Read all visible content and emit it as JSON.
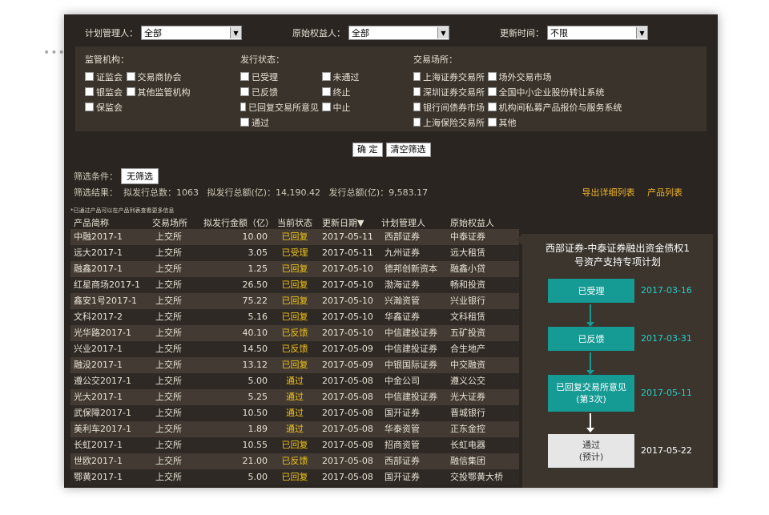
{
  "filters": {
    "plan_manager": {
      "label": "计划管理人：",
      "value": "全部"
    },
    "original_owner": {
      "label": "原始权益人：",
      "value": "全部"
    },
    "update_time": {
      "label": "更新时间：",
      "value": "不限"
    }
  },
  "regulators": {
    "title": "监管机构：",
    "options": [
      "证监会",
      "交易商协会",
      "银监会",
      "其他监管机构",
      "保监会"
    ]
  },
  "issue_status": {
    "title": "发行状态：",
    "options": [
      "已受理",
      "未通过",
      "已反馈",
      "终止",
      "已回复交易所意见",
      "中止",
      "通过"
    ]
  },
  "exchange": {
    "title": "交易场所：",
    "options": [
      "上海证券交易所",
      "场外交易市场",
      "深圳证券交易所",
      "全国中小企业股份转让系统",
      "银行间债券市场",
      "机构间私募产品报价与服务系统",
      "上海保险交易所",
      "其他"
    ]
  },
  "buttons": {
    "confirm": "确 定",
    "clear": "清空筛选"
  },
  "summary": {
    "cond_label": "筛选条件：",
    "cond_value": "无筛选",
    "result_text": "筛选结果：  拟发行总数：1063   拟发行总额(亿)：14,190.42   发行总额(亿)：9,583.17"
  },
  "links": {
    "export": "导出详细列表",
    "product_list": "产品列表"
  },
  "note": "*已通过产品可以在产品列表查看更多信息",
  "table": {
    "headers": [
      "产品简称",
      "交易场所",
      "拟发行金额（亿）",
      "当前状态",
      "更新日期▼",
      "计划管理人",
      "原始权益人"
    ],
    "rows": [
      [
        "中融2017-1",
        "上交所",
        "10.00",
        "已回复",
        "2017-05-11",
        "西部证券",
        "中泰证券"
      ],
      [
        "远大2017-1",
        "上交所",
        "3.05",
        "已受理",
        "2017-05-11",
        "九州证券",
        "远大租赁"
      ],
      [
        "融鑫2017-1",
        "上交所",
        "1.25",
        "已回复",
        "2017-05-10",
        "德邦创新资本",
        "融鑫小贷"
      ],
      [
        "红星商场2017-1",
        "上交所",
        "26.50",
        "已回复",
        "2017-05-10",
        "渤海证券",
        "畅和投资"
      ],
      [
        "鑫安1号2017-1",
        "上交所",
        "75.22",
        "已回复",
        "2017-05-10",
        "兴瀚资管",
        "兴业银行"
      ],
      [
        "文科2017-2",
        "上交所",
        "5.16",
        "已回复",
        "2017-05-10",
        "华鑫证券",
        "文科租赁"
      ],
      [
        "光华路2017-1",
        "上交所",
        "40.10",
        "已反馈",
        "2017-05-10",
        "中信建投证券",
        "五矿投资"
      ],
      [
        "兴业2017-1",
        "上交所",
        "14.50",
        "已反馈",
        "2017-05-09",
        "中信建投证券",
        "合生地产"
      ],
      [
        "融没2017-1",
        "上交所",
        "13.12",
        "已回复",
        "2017-05-09",
        "中银国际证券",
        "中交融资"
      ],
      [
        "遵公交2017-1",
        "上交所",
        "5.00",
        "通过",
        "2017-05-08",
        "中金公司",
        "遵义公交"
      ],
      [
        "光大2017-1",
        "上交所",
        "5.25",
        "通过",
        "2017-05-08",
        "中信建投证券",
        "光大证券"
      ],
      [
        "武保障2017-1",
        "上交所",
        "10.50",
        "通过",
        "2017-05-08",
        "国开证券",
        "晋城银行"
      ],
      [
        "美利车2017-1",
        "上交所",
        "1.89",
        "通过",
        "2017-05-08",
        "华泰资管",
        "正东金控"
      ],
      [
        "长虹2017-1",
        "上交所",
        "10.55",
        "已回复",
        "2017-05-08",
        "招商资管",
        "长虹电器"
      ],
      [
        "世欧2017-1",
        "上交所",
        "21.00",
        "已反馈",
        "2017-05-08",
        "西部证券",
        "融信集团"
      ],
      [
        "鄂黄2017-1",
        "上交所",
        "5.00",
        "已回复",
        "2017-05-08",
        "国开证券",
        "交投鄂黄大桥"
      ]
    ]
  },
  "detail": {
    "title_line1": "西部证券-中泰证券融出资金债权1",
    "title_line2": "号资产支持专项计划",
    "steps": [
      {
        "label": "已受理",
        "sub": "",
        "date": "2017-03-16"
      },
      {
        "label": "已反馈",
        "sub": "",
        "date": "2017-03-31"
      },
      {
        "label": "已回复交易所意见",
        "sub": "(第3次)",
        "date": "2017-05-11"
      },
      {
        "label": "通过",
        "sub": "(预计)",
        "date": "2017-05-22"
      }
    ]
  },
  "colors": {
    "bg": "#2a2520",
    "accent": "#f0b429",
    "teal": "#169a94"
  }
}
